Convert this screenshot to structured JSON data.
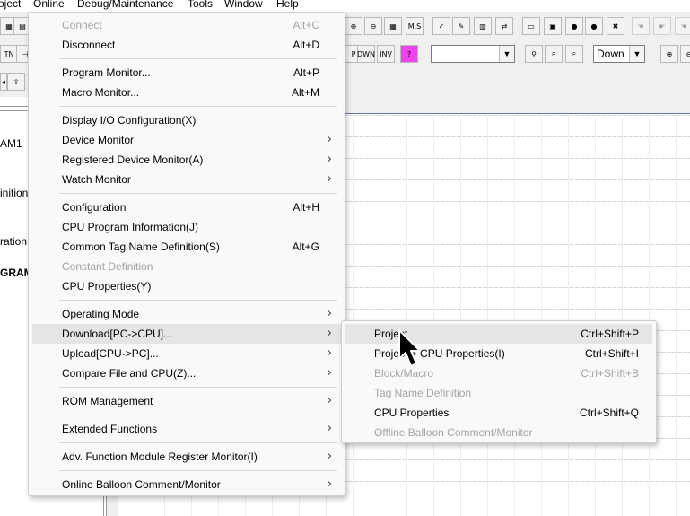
{
  "menubar": {
    "items": [
      "oject",
      "Online",
      "Debug/Maintenance",
      "Tools",
      "Window",
      "Help"
    ]
  },
  "toolbar": {
    "row2_buttons": [
      "P",
      "DWN",
      "INV",
      "?"
    ],
    "combo_empty": "",
    "combo_direction": "Down"
  },
  "left_panel": {
    "lines": [
      "AM1",
      "inition",
      "ration",
      "GRAM)"
    ]
  },
  "online_menu": {
    "items": [
      {
        "label": "Connect",
        "shortcut": "Alt+C",
        "disabled": true,
        "submenu": false
      },
      {
        "label": "Disconnect",
        "shortcut": "Alt+D",
        "disabled": false,
        "submenu": false
      },
      {
        "label": "Program Monitor...",
        "shortcut": "Alt+P",
        "disabled": false,
        "submenu": false
      },
      {
        "label": "Macro Monitor...",
        "shortcut": "Alt+M",
        "disabled": false,
        "submenu": false
      },
      {
        "label": "Display I/O Configuration(X)",
        "shortcut": "",
        "disabled": false,
        "submenu": false
      },
      {
        "label": "Device Monitor",
        "shortcut": "",
        "disabled": false,
        "submenu": true
      },
      {
        "label": "Registered Device Monitor(A)",
        "shortcut": "",
        "disabled": false,
        "submenu": true
      },
      {
        "label": "Watch Monitor",
        "shortcut": "",
        "disabled": false,
        "submenu": true
      },
      {
        "label": "Configuration",
        "shortcut": "Alt+H",
        "disabled": false,
        "submenu": false
      },
      {
        "label": "CPU Program Information(J)",
        "shortcut": "",
        "disabled": false,
        "submenu": false
      },
      {
        "label": "Common Tag Name Definition(S)",
        "shortcut": "Alt+G",
        "disabled": false,
        "submenu": false
      },
      {
        "label": "Constant Definition",
        "shortcut": "",
        "disabled": true,
        "submenu": false
      },
      {
        "label": "CPU Properties(Y)",
        "shortcut": "",
        "disabled": false,
        "submenu": false
      },
      {
        "label": "Operating Mode",
        "shortcut": "",
        "disabled": false,
        "submenu": true
      },
      {
        "label": "Download[PC->CPU]...",
        "shortcut": "",
        "disabled": false,
        "submenu": true
      },
      {
        "label": "Upload[CPU->PC]...",
        "shortcut": "",
        "disabled": false,
        "submenu": true
      },
      {
        "label": "Compare File and CPU(Z)...",
        "shortcut": "",
        "disabled": false,
        "submenu": true
      },
      {
        "label": "ROM Management",
        "shortcut": "",
        "disabled": false,
        "submenu": true
      },
      {
        "label": "Extended Functions",
        "shortcut": "",
        "disabled": false,
        "submenu": true
      },
      {
        "label": "Adv. Function Module Register Monitor(I)",
        "shortcut": "",
        "disabled": false,
        "submenu": true
      },
      {
        "label": "Online Balloon Comment/Monitor",
        "shortcut": "",
        "disabled": false,
        "submenu": true
      }
    ]
  },
  "download_submenu": {
    "items": [
      {
        "label": "Project",
        "shortcut": "Ctrl+Shift+P",
        "disabled": false
      },
      {
        "label": "Project + CPU Properties(I)",
        "shortcut": "Ctrl+Shift+I",
        "disabled": false
      },
      {
        "label": "Block/Macro",
        "shortcut": "Ctrl+Shift+B",
        "disabled": true
      },
      {
        "label": "Tag Name Definition",
        "shortcut": "",
        "disabled": true
      },
      {
        "label": "CPU Properties",
        "shortcut": "Ctrl+Shift+Q",
        "disabled": false
      },
      {
        "label": "Offline Balloon Comment/Monitor",
        "shortcut": "",
        "disabled": true
      }
    ]
  },
  "colors": {
    "menu_bg": "#f9f9f9",
    "highlight": "#e5e5e5",
    "disabled_text": "#a3a3a3",
    "toolbar_bg": "#f0f0f0"
  }
}
